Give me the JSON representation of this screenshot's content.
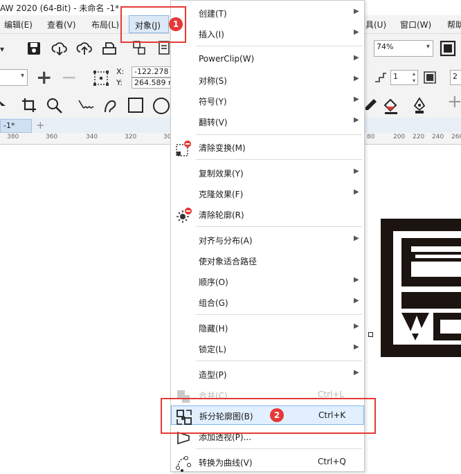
{
  "window": {
    "title": "AW 2020 (64-Bit) - 未命名 -1*"
  },
  "menubar": {
    "items": [
      "编辑(E)",
      "查看(V)",
      "布局(L)",
      "对象(J)",
      "具(U)",
      "窗口(W)",
      "帮助"
    ]
  },
  "toolbar": {
    "zoom": "74%"
  },
  "property_bar": {
    "x_label": "X:",
    "y_label": "Y:",
    "x_value": "-122.278 r",
    "y_value": "264.589 m",
    "count_value": "1",
    "right_value": "2"
  },
  "tab": {
    "label": "-1*",
    "add": "+"
  },
  "ruler": {
    "ticks": [
      "380",
      "360",
      "340",
      "320",
      "30",
      "80",
      "200",
      "220",
      "240",
      "260"
    ]
  },
  "context_menu": {
    "items": [
      {
        "label": "创建(T)",
        "shortcut": "",
        "submenu": true,
        "disabled": false
      },
      {
        "label": "插入(I)",
        "shortcut": "",
        "submenu": true,
        "disabled": false
      },
      {
        "label": "PowerClip(W)",
        "shortcut": "",
        "submenu": true,
        "disabled": false
      },
      {
        "label": "对称(S)",
        "shortcut": "",
        "submenu": true,
        "disabled": false
      },
      {
        "label": "符号(Y)",
        "shortcut": "",
        "submenu": true,
        "disabled": false
      },
      {
        "label": "翻转(V)",
        "shortcut": "",
        "submenu": true,
        "disabled": false
      },
      {
        "label": "清除变换(M)",
        "shortcut": "",
        "submenu": false,
        "disabled": false,
        "icon": "clear-transform-icon"
      },
      {
        "label": "复制效果(Y)",
        "shortcut": "",
        "submenu": true,
        "disabled": false
      },
      {
        "label": "克隆效果(F)",
        "shortcut": "",
        "submenu": true,
        "disabled": false
      },
      {
        "label": "清除轮廓(R)",
        "shortcut": "",
        "submenu": false,
        "disabled": false,
        "icon": "clear-outline-icon"
      },
      {
        "label": "对齐与分布(A)",
        "shortcut": "",
        "submenu": true,
        "disabled": false
      },
      {
        "label": "使对象适合路径",
        "shortcut": "",
        "submenu": false,
        "disabled": false
      },
      {
        "label": "顺序(O)",
        "shortcut": "",
        "submenu": true,
        "disabled": false
      },
      {
        "label": "组合(G)",
        "shortcut": "",
        "submenu": true,
        "disabled": false
      },
      {
        "label": "隐藏(H)",
        "shortcut": "",
        "submenu": true,
        "disabled": false
      },
      {
        "label": "锁定(L)",
        "shortcut": "",
        "submenu": true,
        "disabled": false
      },
      {
        "label": "造型(P)",
        "shortcut": "",
        "submenu": true,
        "disabled": false
      },
      {
        "label": "合并(C)",
        "shortcut": "Ctrl+L",
        "submenu": false,
        "disabled": true,
        "icon": "combine-icon"
      },
      {
        "label": "拆分轮廓图(B)",
        "shortcut": "Ctrl+K",
        "submenu": false,
        "disabled": false,
        "highlighted": true,
        "icon": "break-apart-icon"
      },
      {
        "label": "添加透视(P)...",
        "shortcut": "",
        "submenu": false,
        "disabled": false,
        "icon": "perspective-icon"
      },
      {
        "label": "转换为曲线(V)",
        "shortcut": "Ctrl+Q",
        "submenu": false,
        "disabled": false,
        "icon": "convert-curves-icon"
      }
    ]
  },
  "annotations": {
    "badge1": "1",
    "badge2": "2"
  },
  "colors": {
    "accent": "#e53935",
    "highlight": "#e1efff",
    "highlight_border": "#7fb3e6"
  }
}
